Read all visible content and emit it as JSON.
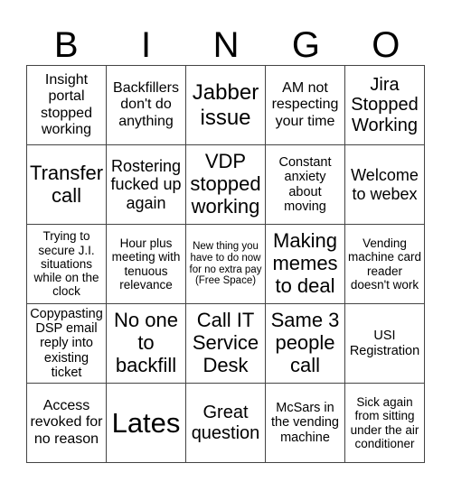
{
  "header": [
    "B",
    "I",
    "N",
    "G",
    "O"
  ],
  "cells": [
    "Insight portal stopped working",
    "Backfillers don't do anything",
    "Jabber issue",
    "AM not respecting your time",
    "Jira Stopped Working",
    "Transfer call",
    "Rostering fucked up again",
    "VDP stopped working",
    "Constant anxiety about moving",
    "Welcome to webex",
    "Trying to secure J.I. situations while on the clock",
    "Hour plus meeting with tenuous relevance",
    "New thing you have to do now for no extra pay (Free Space)",
    "Making memes to deal",
    "Vending machine card reader doesn't work",
    "Copypasting DSP email reply into existing ticket",
    "No one to backfill",
    "Call IT Service Desk",
    "Same 3 people call",
    "USI Registration",
    "Access revoked for no reason",
    "Lates",
    "Great question",
    "McSars in the vending machine",
    "Sick again from sitting under the air conditioner"
  ]
}
